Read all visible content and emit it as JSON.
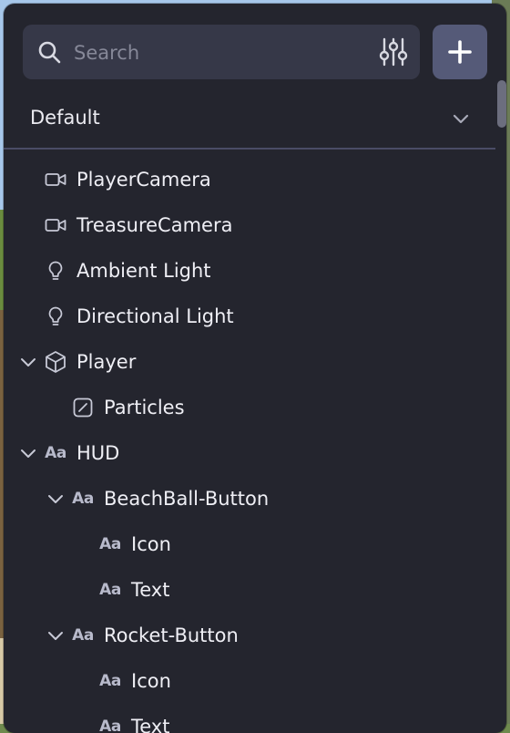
{
  "search": {
    "placeholder": "Search"
  },
  "scene_selector": {
    "value": "Default"
  },
  "tree": [
    {
      "label": "PlayerCamera",
      "icon": "camera-icon",
      "depth": 0,
      "expander": "none"
    },
    {
      "label": "TreasureCamera",
      "icon": "camera-icon",
      "depth": 0,
      "expander": "none"
    },
    {
      "label": "Ambient Light",
      "icon": "lightbulb-icon",
      "depth": 0,
      "expander": "none"
    },
    {
      "label": "Directional Light",
      "icon": "lightbulb-icon",
      "depth": 0,
      "expander": "none"
    },
    {
      "label": "Player",
      "icon": "cube-icon",
      "depth": 0,
      "expander": "expanded"
    },
    {
      "label": "Particles",
      "icon": "particles-icon",
      "depth": 1,
      "expander": "none"
    },
    {
      "label": "HUD",
      "icon": "text-icon",
      "depth": 0,
      "expander": "expanded"
    },
    {
      "label": "BeachBall-Button",
      "icon": "text-icon",
      "depth": 1,
      "expander": "expanded"
    },
    {
      "label": "Icon",
      "icon": "text-icon",
      "depth": 2,
      "expander": "none"
    },
    {
      "label": "Text",
      "icon": "text-icon",
      "depth": 2,
      "expander": "none"
    },
    {
      "label": "Rocket-Button",
      "icon": "text-icon",
      "depth": 1,
      "expander": "expanded"
    },
    {
      "label": "Icon",
      "icon": "text-icon",
      "depth": 2,
      "expander": "none"
    },
    {
      "label": "Text",
      "icon": "text-icon",
      "depth": 2,
      "expander": "none"
    }
  ],
  "text_icon_glyph": "Aa",
  "colors": {
    "panel": "#24252e",
    "search_bg": "#363848",
    "add_button": "#555a78",
    "divider": "#4a4c66"
  }
}
